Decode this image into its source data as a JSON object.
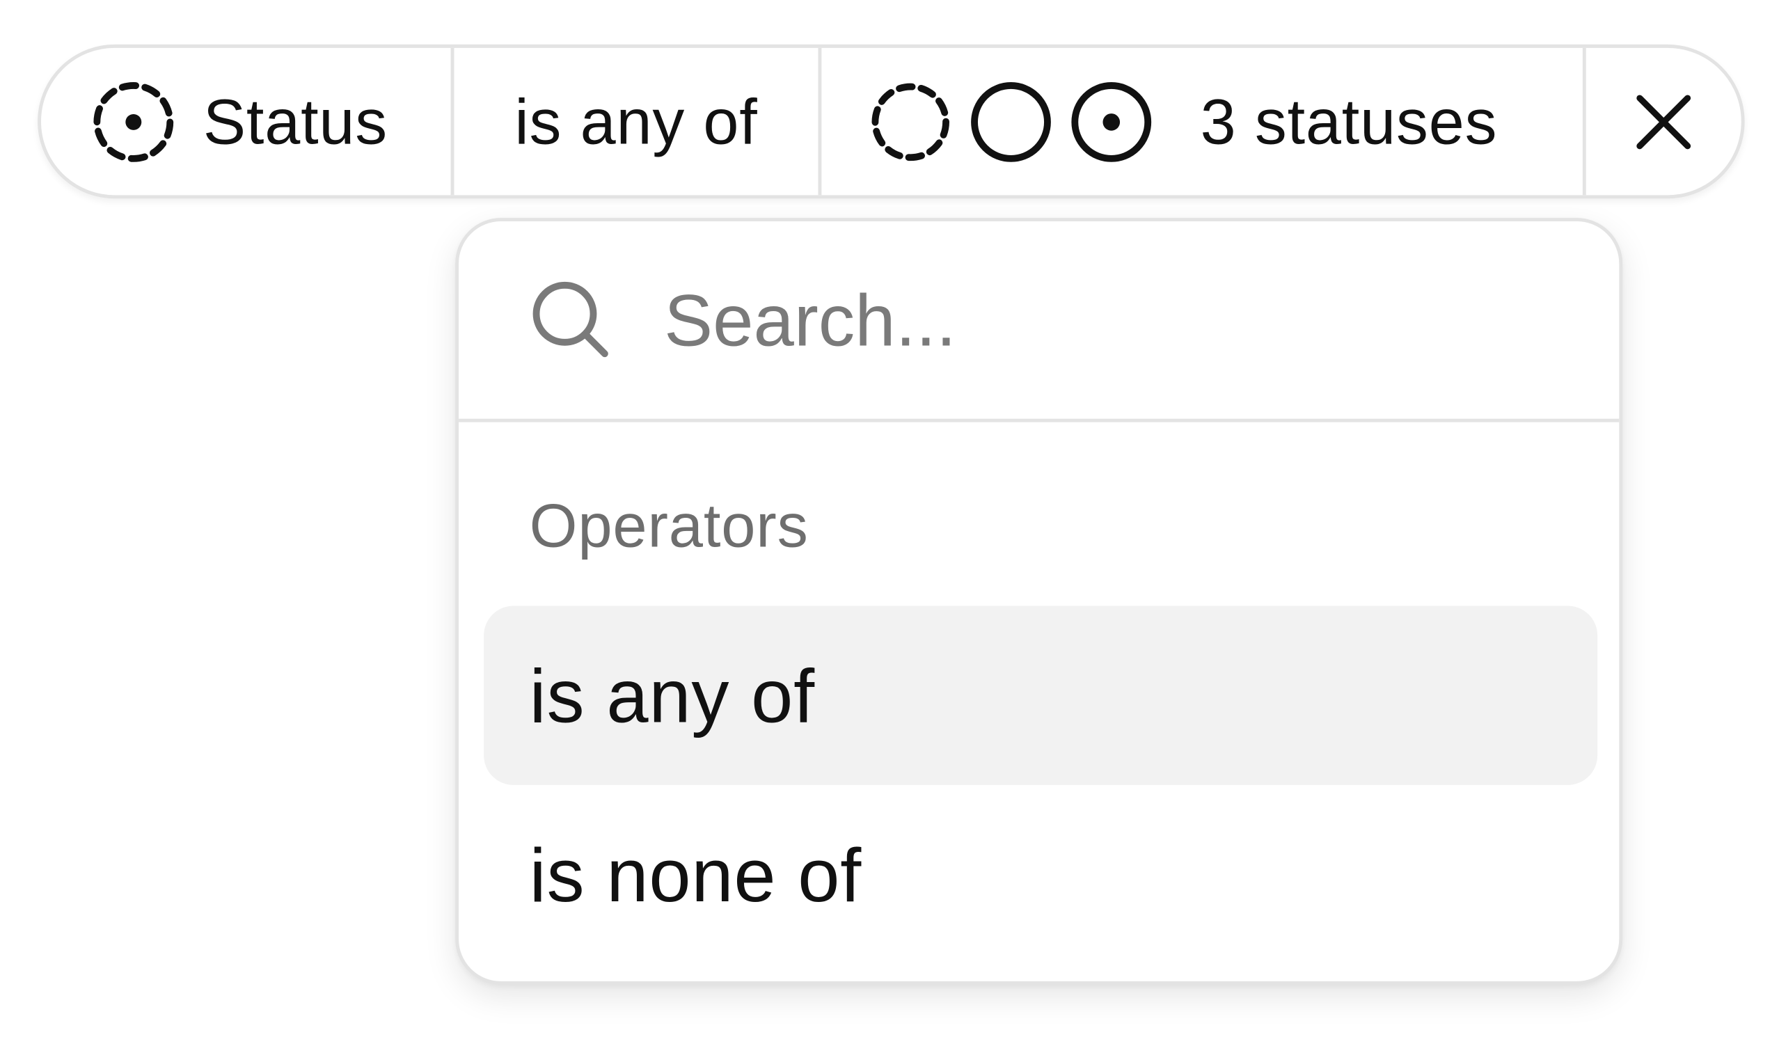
{
  "filter": {
    "field_label": "Status",
    "operator_label": "is any of",
    "value_label": "3 statuses",
    "status_icons": [
      "status-dashed-circle-icon",
      "status-empty-circle-icon",
      "status-dot-circle-icon"
    ],
    "field_icon": "status-dashed-dot-icon",
    "remove_icon": "close-icon"
  },
  "dropdown": {
    "search": {
      "placeholder": "Search...",
      "value": "",
      "icon": "search-icon"
    },
    "group_label": "Operators",
    "options": [
      {
        "label": "is any of",
        "highlighted": true
      },
      {
        "label": "is none of",
        "highlighted": false
      }
    ]
  },
  "colors": {
    "border": "#e3e3e3",
    "text": "#111111",
    "muted": "#6e6e6e",
    "placeholder": "#7a7a7a",
    "highlight": "#f2f2f2"
  }
}
